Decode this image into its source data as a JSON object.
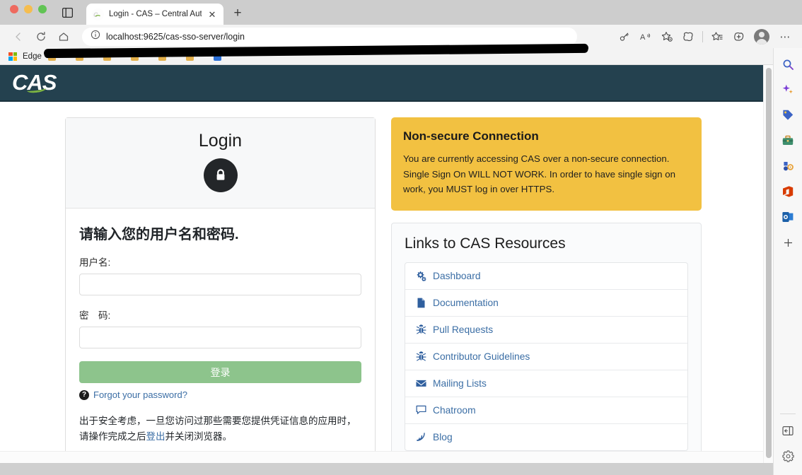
{
  "browser": {
    "tab": {
      "title": "Login - CAS – Central Authenti",
      "close_label": "✕",
      "favicon_text": "CAS"
    },
    "new_tab_label": "+",
    "nav": {
      "back": "←",
      "refresh": "⟳",
      "home": "⌂"
    },
    "omnibox": {
      "info_icon": "ⓘ",
      "url": "localhost:9625/cas-sso-server/login"
    },
    "toolbar_icons": [
      "key-icon",
      "read-aloud-icon",
      "favorites-icon",
      "split-screen-icon",
      "collections-icon",
      "tab-actions-icon",
      "profile-icon",
      "settings-more-icon"
    ],
    "more_label": "⋯",
    "bookmarks": {
      "edge_label": "Edge",
      "items": [
        {
          "label": "",
          "color": "#e3b04b"
        },
        {
          "label": "",
          "color": "#e3b04b"
        },
        {
          "label": "",
          "color": "#e3b04b"
        },
        {
          "label": "",
          "color": "#e3b04b"
        },
        {
          "label": "",
          "color": "#e3b04b"
        },
        {
          "label": "",
          "color": "#e3b04b"
        },
        {
          "label": "",
          "color": "#2b6fd6"
        }
      ]
    }
  },
  "edge_sidebar": {
    "items": [
      {
        "name": "search-icon",
        "glyph": "🔍"
      },
      {
        "name": "copilot-icon",
        "glyph": "✦"
      },
      {
        "name": "shopping-tag-icon",
        "glyph": "🏷"
      },
      {
        "name": "tools-icon",
        "glyph": "🧰"
      },
      {
        "name": "games-icon",
        "glyph": "🎮"
      },
      {
        "name": "office-icon",
        "glyph": "O"
      },
      {
        "name": "outlook-icon",
        "glyph": "📧"
      },
      {
        "name": "add-icon",
        "glyph": "+"
      }
    ],
    "bottom": [
      {
        "name": "sidebar-toggle-icon",
        "glyph": "▤"
      },
      {
        "name": "settings-gear-icon",
        "glyph": "⚙"
      }
    ]
  },
  "page": {
    "brand": "CAS",
    "login": {
      "title": "Login",
      "lock_icon": "lock-icon",
      "prompt": "请输入您的用户名和密码.",
      "username_label": "用户名:",
      "username_value": "",
      "password_label": "密　码:",
      "password_value": "",
      "submit_label": "登录",
      "forgot_label": "Forgot your password?",
      "help_icon_glyph": "?",
      "notice_before": "出于安全考虑，一旦您访问过那些需要您提供凭证信息的应用时，请操作完成之后",
      "notice_link": "登出",
      "notice_after": "并关闭浏览器。"
    },
    "warning": {
      "title": "Non-secure Connection",
      "text": "You are currently accessing CAS over a non-secure connection. Single Sign On WILL NOT WORK. In order to have single sign on work, you MUST log in over HTTPS.",
      "bg_color": "#f2c141"
    },
    "resources": {
      "title": "Links to CAS Resources",
      "items": [
        {
          "label": "Dashboard",
          "icon": "cogs-icon"
        },
        {
          "label": "Documentation",
          "icon": "file-icon"
        },
        {
          "label": "Pull Requests",
          "icon": "bug-icon"
        },
        {
          "label": "Contributor Guidelines",
          "icon": "bug-icon"
        },
        {
          "label": "Mailing Lists",
          "icon": "envelope-icon"
        },
        {
          "label": "Chatroom",
          "icon": "comment-icon"
        },
        {
          "label": "Blog",
          "icon": "rss-icon"
        }
      ]
    },
    "colors": {
      "header": "#24414f",
      "accent_green": "#8dc48c",
      "link": "#3b6ea5"
    }
  }
}
